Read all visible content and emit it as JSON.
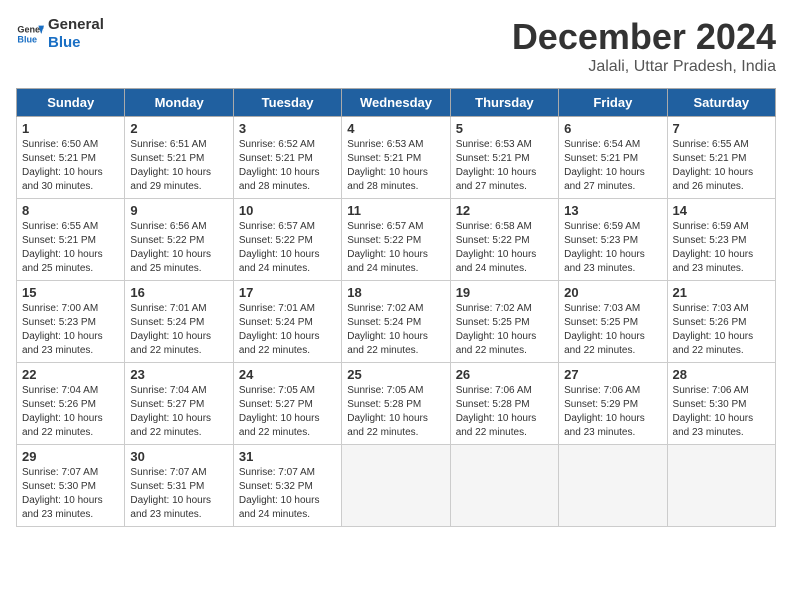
{
  "logo": {
    "line1": "General",
    "line2": "Blue"
  },
  "title": "December 2024",
  "subtitle": "Jalali, Uttar Pradesh, India",
  "days_of_week": [
    "Sunday",
    "Monday",
    "Tuesday",
    "Wednesday",
    "Thursday",
    "Friday",
    "Saturday"
  ],
  "weeks": [
    [
      {
        "day": 1,
        "info": "Sunrise: 6:50 AM\nSunset: 5:21 PM\nDaylight: 10 hours\nand 30 minutes."
      },
      {
        "day": 2,
        "info": "Sunrise: 6:51 AM\nSunset: 5:21 PM\nDaylight: 10 hours\nand 29 minutes."
      },
      {
        "day": 3,
        "info": "Sunrise: 6:52 AM\nSunset: 5:21 PM\nDaylight: 10 hours\nand 28 minutes."
      },
      {
        "day": 4,
        "info": "Sunrise: 6:53 AM\nSunset: 5:21 PM\nDaylight: 10 hours\nand 28 minutes."
      },
      {
        "day": 5,
        "info": "Sunrise: 6:53 AM\nSunset: 5:21 PM\nDaylight: 10 hours\nand 27 minutes."
      },
      {
        "day": 6,
        "info": "Sunrise: 6:54 AM\nSunset: 5:21 PM\nDaylight: 10 hours\nand 27 minutes."
      },
      {
        "day": 7,
        "info": "Sunrise: 6:55 AM\nSunset: 5:21 PM\nDaylight: 10 hours\nand 26 minutes."
      }
    ],
    [
      {
        "day": 8,
        "info": "Sunrise: 6:55 AM\nSunset: 5:21 PM\nDaylight: 10 hours\nand 25 minutes."
      },
      {
        "day": 9,
        "info": "Sunrise: 6:56 AM\nSunset: 5:22 PM\nDaylight: 10 hours\nand 25 minutes."
      },
      {
        "day": 10,
        "info": "Sunrise: 6:57 AM\nSunset: 5:22 PM\nDaylight: 10 hours\nand 24 minutes."
      },
      {
        "day": 11,
        "info": "Sunrise: 6:57 AM\nSunset: 5:22 PM\nDaylight: 10 hours\nand 24 minutes."
      },
      {
        "day": 12,
        "info": "Sunrise: 6:58 AM\nSunset: 5:22 PM\nDaylight: 10 hours\nand 24 minutes."
      },
      {
        "day": 13,
        "info": "Sunrise: 6:59 AM\nSunset: 5:23 PM\nDaylight: 10 hours\nand 23 minutes."
      },
      {
        "day": 14,
        "info": "Sunrise: 6:59 AM\nSunset: 5:23 PM\nDaylight: 10 hours\nand 23 minutes."
      }
    ],
    [
      {
        "day": 15,
        "info": "Sunrise: 7:00 AM\nSunset: 5:23 PM\nDaylight: 10 hours\nand 23 minutes."
      },
      {
        "day": 16,
        "info": "Sunrise: 7:01 AM\nSunset: 5:24 PM\nDaylight: 10 hours\nand 22 minutes."
      },
      {
        "day": 17,
        "info": "Sunrise: 7:01 AM\nSunset: 5:24 PM\nDaylight: 10 hours\nand 22 minutes."
      },
      {
        "day": 18,
        "info": "Sunrise: 7:02 AM\nSunset: 5:24 PM\nDaylight: 10 hours\nand 22 minutes."
      },
      {
        "day": 19,
        "info": "Sunrise: 7:02 AM\nSunset: 5:25 PM\nDaylight: 10 hours\nand 22 minutes."
      },
      {
        "day": 20,
        "info": "Sunrise: 7:03 AM\nSunset: 5:25 PM\nDaylight: 10 hours\nand 22 minutes."
      },
      {
        "day": 21,
        "info": "Sunrise: 7:03 AM\nSunset: 5:26 PM\nDaylight: 10 hours\nand 22 minutes."
      }
    ],
    [
      {
        "day": 22,
        "info": "Sunrise: 7:04 AM\nSunset: 5:26 PM\nDaylight: 10 hours\nand 22 minutes."
      },
      {
        "day": 23,
        "info": "Sunrise: 7:04 AM\nSunset: 5:27 PM\nDaylight: 10 hours\nand 22 minutes."
      },
      {
        "day": 24,
        "info": "Sunrise: 7:05 AM\nSunset: 5:27 PM\nDaylight: 10 hours\nand 22 minutes."
      },
      {
        "day": 25,
        "info": "Sunrise: 7:05 AM\nSunset: 5:28 PM\nDaylight: 10 hours\nand 22 minutes."
      },
      {
        "day": 26,
        "info": "Sunrise: 7:06 AM\nSunset: 5:28 PM\nDaylight: 10 hours\nand 22 minutes."
      },
      {
        "day": 27,
        "info": "Sunrise: 7:06 AM\nSunset: 5:29 PM\nDaylight: 10 hours\nand 23 minutes."
      },
      {
        "day": 28,
        "info": "Sunrise: 7:06 AM\nSunset: 5:30 PM\nDaylight: 10 hours\nand 23 minutes."
      }
    ],
    [
      {
        "day": 29,
        "info": "Sunrise: 7:07 AM\nSunset: 5:30 PM\nDaylight: 10 hours\nand 23 minutes."
      },
      {
        "day": 30,
        "info": "Sunrise: 7:07 AM\nSunset: 5:31 PM\nDaylight: 10 hours\nand 23 minutes."
      },
      {
        "day": 31,
        "info": "Sunrise: 7:07 AM\nSunset: 5:32 PM\nDaylight: 10 hours\nand 24 minutes."
      },
      null,
      null,
      null,
      null
    ]
  ]
}
